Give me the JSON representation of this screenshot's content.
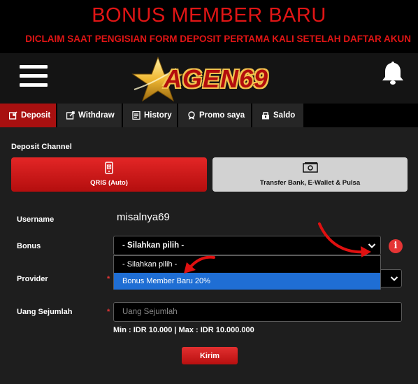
{
  "banner": {
    "title": "BONUS MEMBER BARU",
    "subtitle": "DICLAIM SAAT PENGISIAN FORM DEPOSIT PERTAMA KALI SETELAH DAFTAR AKUN"
  },
  "header": {
    "logo_text": "AGEN69",
    "menu_icon": "hamburger-menu-icon",
    "bell_icon": "bell-icon"
  },
  "tabs": [
    {
      "label": "Deposit",
      "icon": "deposit-icon",
      "active": true
    },
    {
      "label": "Withdraw",
      "icon": "withdraw-icon",
      "active": false
    },
    {
      "label": "History",
      "icon": "history-icon",
      "active": false
    },
    {
      "label": "Promo saya",
      "icon": "promo-icon",
      "active": false
    },
    {
      "label": "Saldo",
      "icon": "saldo-icon",
      "active": false
    }
  ],
  "deposit": {
    "channel_heading": "Deposit Channel",
    "channels": [
      {
        "label": "QRIS (Auto)",
        "icon": "qris-phone-icon",
        "selected": true
      },
      {
        "label": "Transfer Bank, E-Wallet & Pulsa",
        "icon": "cash-icon",
        "selected": false
      }
    ],
    "form": {
      "username_label": "Username",
      "username_value": "misalnya69",
      "bonus_label": "Bonus",
      "bonus_value": "- Silahkan pilih -",
      "bonus_options": [
        "- Silahkan pilih -",
        "Bonus Member Baru 20%"
      ],
      "bonus_highlighted_option": "Bonus Member Baru 20%",
      "provider_label": "Provider",
      "amount_label": "Uang Sejumlah",
      "amount_placeholder": "Uang Sejumlah",
      "required_mark": "*",
      "limits": "Min : IDR 10.000  |  Max : IDR 10.000.000",
      "info_icon": "info-icon",
      "info_glyph": "i",
      "submit_label": "Kirim"
    }
  },
  "colors": {
    "banner_red": "#e01515",
    "active_tab": "#a81010",
    "highlight_blue": "#1f6ed4",
    "panel_bg": "#1e1e1e",
    "logo_gold": "#f2c14e"
  }
}
